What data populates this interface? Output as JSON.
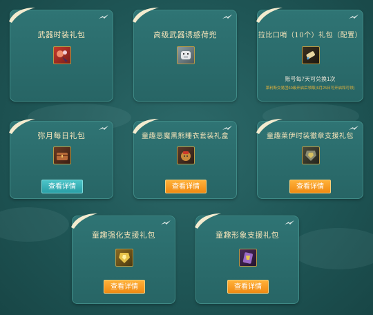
{
  "cards": [
    {
      "title": "武器时装礼包"
    },
    {
      "title": "高级武器诱惑荷兜"
    },
    {
      "title": "拉比口哨（10个）礼包（配置）",
      "note": "账号每7天可兑换1次",
      "note_sub": "莱利斯交易团60级开启后领取(6月25日可开启和可领)"
    },
    {
      "title": "弥月每日礼包",
      "button": "查看详情"
    },
    {
      "title": "童趣恶魔黑熊睡衣套装礼盒",
      "button": "查看详情"
    },
    {
      "title": "童趣莱伊时装徽章支援礼包",
      "button": "查看详情"
    },
    {
      "title": "童趣强化支援礼包",
      "button": "查看详情"
    },
    {
      "title": "童趣形象支援礼包",
      "button": "查看详情"
    }
  ],
  "colors": {
    "teal_button": "#2a9fa6",
    "orange_button": "#f08a12",
    "title": "#f2e2b8",
    "note_highlight": "#e6b43a"
  },
  "icons": [
    "swoosh-ornament-icon",
    "bird-icon",
    "weapon-costume-icon",
    "pig-mask-icon",
    "whistle-icon",
    "treasure-chest-icon",
    "bear-bag-icon",
    "armor-icon",
    "gold-armor-icon",
    "purple-card-icon"
  ]
}
